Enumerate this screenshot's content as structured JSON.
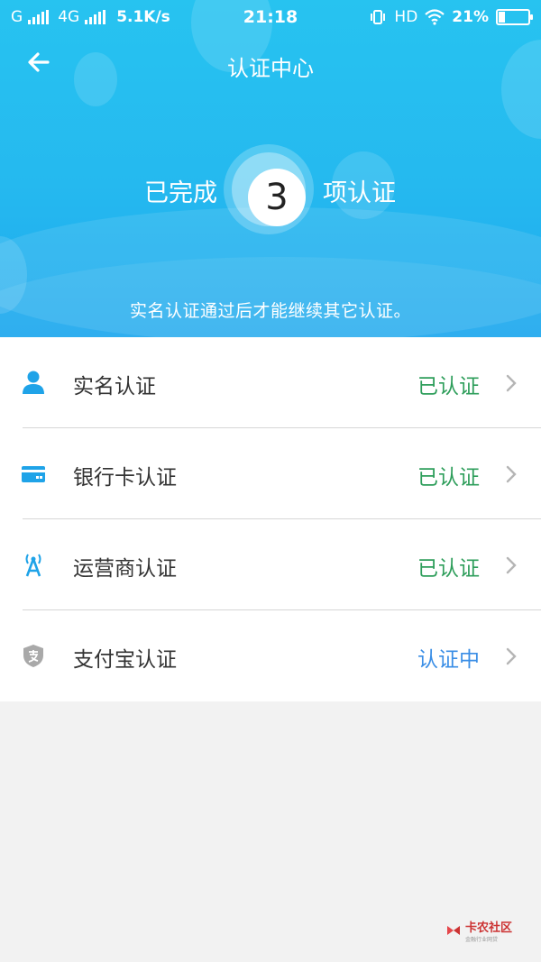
{
  "status_bar": {
    "sim1": "G",
    "sim2": "4G",
    "speed": "5.1K/s",
    "time": "21:18",
    "hd": "HD",
    "battery": "21%",
    "battery_level": 0.21
  },
  "nav": {
    "title": "认证中心",
    "back_icon": "arrow-left-icon"
  },
  "summary": {
    "prefix": "已完成",
    "count": "3",
    "suffix": "项认证",
    "note": "实名认证通过后才能继续其它认证。"
  },
  "items": [
    {
      "label": "实名认证",
      "status": "已认证",
      "icon": "person-icon",
      "status_color": "#2e9e5b"
    },
    {
      "label": "银行卡认证",
      "status": "已认证",
      "icon": "bank-card-icon",
      "status_color": "#2e9e5b"
    },
    {
      "label": "运营商认证",
      "status": "已认证",
      "icon": "antenna-icon",
      "status_color": "#2e9e5b"
    },
    {
      "label": "支付宝认证",
      "status": "认证中",
      "icon": "alipay-shield-icon",
      "status_color": "#3a8ee6"
    }
  ],
  "watermark": {
    "text": "卡农社区",
    "sub": "金融行业网贷"
  },
  "colors": {
    "header": "#25b9ef",
    "accent_icon": "#1fa3e8",
    "verified": "#2e9e5b",
    "pending": "#3a8ee6"
  }
}
